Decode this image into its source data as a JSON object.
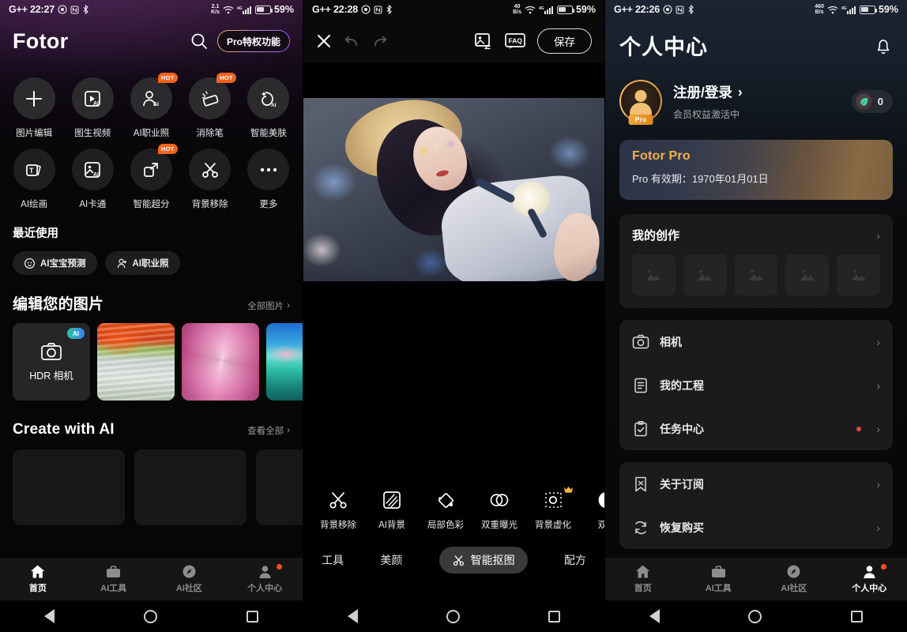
{
  "screen1": {
    "statusbar": {
      "left_text": "G++ 22:27",
      "net_speed_value": "2.1",
      "net_speed_unit": "K/s",
      "signal_label": "4G",
      "battery": "59%"
    },
    "header": {
      "app_title": "Fotor",
      "search_icon": "search-icon",
      "pro_button": "Pro特权功能"
    },
    "tools": [
      {
        "label": "图片编辑",
        "icon": "plus-icon",
        "badge": ""
      },
      {
        "label": "图生视频",
        "icon": "video-ai-icon",
        "badge": ""
      },
      {
        "label": "AI职业照",
        "icon": "person-ai-icon",
        "badge": "HOT"
      },
      {
        "label": "消除笔",
        "icon": "eraser-icon",
        "badge": "HOT"
      },
      {
        "label": "智能美肤",
        "icon": "skin-ai-icon",
        "badge": ""
      },
      {
        "label": "AI绘画",
        "icon": "text-cards-icon",
        "badge": ""
      },
      {
        "label": "AI卡通",
        "icon": "image-ai-icon",
        "badge": ""
      },
      {
        "label": "智能超分",
        "icon": "expand-icon",
        "badge": "HOT"
      },
      {
        "label": "背景移除",
        "icon": "scissors-icon",
        "badge": ""
      },
      {
        "label": "更多",
        "icon": "ellipsis-icon",
        "badge": ""
      }
    ],
    "recent": {
      "title": "最近使用",
      "chips": [
        {
          "label": "AI宝宝预测",
          "icon": "baby-face-icon"
        },
        {
          "label": "AI职业照",
          "icon": "person-icon"
        }
      ]
    },
    "edit_section": {
      "title": "编辑您的图片",
      "more": "全部图片",
      "hdr_label": "HDR 相机",
      "hdr_badge": "AI",
      "hdr_icon": "camera-icon"
    },
    "create_section": {
      "title": "Create with AI",
      "more": "查看全部"
    },
    "tabbar": [
      {
        "label": "首页",
        "icon": "home-icon",
        "active": true,
        "dot": false
      },
      {
        "label": "AI工具",
        "icon": "toolbox-icon",
        "active": false,
        "dot": false
      },
      {
        "label": "AI社区",
        "icon": "compass-icon",
        "active": false,
        "dot": false
      },
      {
        "label": "个人中心",
        "icon": "person-icon",
        "active": false,
        "dot": true
      }
    ]
  },
  "screen2": {
    "statusbar": {
      "left_text": "G++ 22:28",
      "net_speed_value": "40",
      "net_speed_unit": "B/s",
      "signal_label": "4G",
      "battery": "59%"
    },
    "toolbar": {
      "close_icon": "close-icon",
      "undo_icon": "undo-icon",
      "redo_icon": "redo-icon",
      "compare_icon": "image-swap-icon",
      "faq_label": "FAQ",
      "save_label": "保存"
    },
    "tools": [
      {
        "label": "背景移除",
        "icon": "scissors-icon",
        "pro": false
      },
      {
        "label": "AI背景",
        "icon": "ai-background-icon",
        "pro": false
      },
      {
        "label": "局部色彩",
        "icon": "paint-bucket-icon",
        "pro": false
      },
      {
        "label": "双重曝光",
        "icon": "double-exposure-icon",
        "pro": false
      },
      {
        "label": "背景虚化",
        "icon": "blur-icon",
        "pro": true
      },
      {
        "label": "双色",
        "icon": "duotone-icon",
        "pro": false
      }
    ],
    "tabs": [
      {
        "label": "工具",
        "active": false,
        "icon": ""
      },
      {
        "label": "美颜",
        "active": false,
        "icon": ""
      },
      {
        "label": "智能抠图",
        "active": true,
        "icon": "scissors-icon"
      },
      {
        "label": "配方",
        "active": false,
        "icon": ""
      }
    ]
  },
  "screen3": {
    "statusbar": {
      "left_text": "G++ 22:26",
      "net_speed_value": "460",
      "net_speed_unit": "B/s",
      "signal_label": "4G",
      "battery": "59%"
    },
    "header": {
      "title": "个人中心",
      "bell_icon": "bell-icon"
    },
    "profile": {
      "name": "注册/登录",
      "subtitle": "会员权益激活中",
      "avatar_badge": "Pro",
      "points": "0",
      "points_icon": "leaf-icon"
    },
    "pro_card": {
      "title": "Fotor Pro",
      "expiry": "Pro 有效期：1970年01月01日"
    },
    "works_card": {
      "title": "我的创作",
      "placeholder_count": 5,
      "placeholder_icon": "image-placeholder-icon"
    },
    "menu_group_1": [
      {
        "label": "相机",
        "icon": "camera-icon",
        "dot": false
      },
      {
        "label": "我的工程",
        "icon": "document-icon",
        "dot": false
      },
      {
        "label": "任务中心",
        "icon": "task-check-icon",
        "dot": true
      }
    ],
    "menu_group_2": [
      {
        "label": "关于订阅",
        "icon": "bookmark-icon",
        "dot": false
      },
      {
        "label": "恢复购买",
        "icon": "refresh-icon",
        "dot": false
      }
    ],
    "tabbar": [
      {
        "label": "首页",
        "icon": "home-icon",
        "active": false,
        "dot": false
      },
      {
        "label": "AI工具",
        "icon": "toolbox-icon",
        "active": false,
        "dot": false
      },
      {
        "label": "AI社区",
        "icon": "compass-icon",
        "active": false,
        "dot": false
      },
      {
        "label": "个人中心",
        "icon": "person-icon",
        "active": true,
        "dot": true
      }
    ]
  },
  "navbar": {
    "back_icon": "back-triangle-icon",
    "home_icon": "home-circle-icon",
    "recents_icon": "recents-square-icon"
  },
  "colors": {
    "accent_orange": "#f4631e",
    "pro_gold": "#f2b24a",
    "badge_red": "#e84646",
    "ai_badge": "#2bc4a0"
  }
}
